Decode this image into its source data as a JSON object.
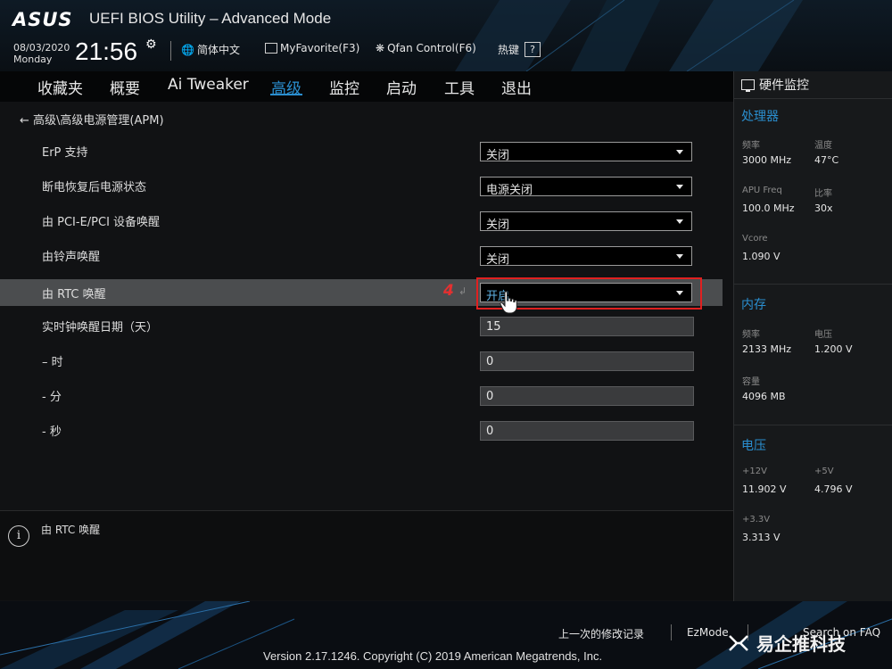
{
  "header": {
    "logo": "ASUS",
    "title": "UEFI BIOS Utility – Advanced Mode",
    "date": "08/03/2020",
    "weekday": "Monday",
    "time": "21:56",
    "tools": {
      "language": "简体中文",
      "myfavorite": "MyFavorite(F3)",
      "qfan": "Qfan Control(F6)",
      "hotkey": "热键",
      "hotkey_key": "?"
    }
  },
  "menu": {
    "items": [
      {
        "label": "收藏夹"
      },
      {
        "label": "概要"
      },
      {
        "label": "Ai Tweaker"
      },
      {
        "label": "高级",
        "active": true
      },
      {
        "label": "监控"
      },
      {
        "label": "启动"
      },
      {
        "label": "工具"
      },
      {
        "label": "退出"
      }
    ]
  },
  "breadcrumb": "高级\\高级电源管理(APM)",
  "settings": [
    {
      "label": "ErP 支持",
      "value": "关闭",
      "kind": "dropdown"
    },
    {
      "label": "断电恢复后电源状态",
      "value": "电源关闭",
      "kind": "dropdown"
    },
    {
      "label": "由 PCI-E/PCI 设备唤醒",
      "value": "关闭",
      "kind": "dropdown"
    },
    {
      "label": "由铃声唤醒",
      "value": "关闭",
      "kind": "dropdown"
    },
    {
      "label": "由 RTC 唤醒",
      "value": "开启",
      "kind": "dropdown",
      "selected": true
    },
    {
      "label": "实时钟唤醒日期（天）",
      "value": "15",
      "kind": "text"
    },
    {
      "label": "– 时",
      "value": "0",
      "kind": "text"
    },
    {
      "label": "- 分",
      "value": "0",
      "kind": "text"
    },
    {
      "label": "- 秒",
      "value": "0",
      "kind": "text"
    }
  ],
  "annotation": {
    "step": "4"
  },
  "info": {
    "text": "由 RTC 唤醒"
  },
  "hw_monitor": {
    "title": "硬件监控",
    "cpu": {
      "title": "处理器",
      "freq_label": "频率",
      "freq": "3000 MHz",
      "temp_label": "温度",
      "temp": "47°C",
      "apu_label": "APU Freq",
      "apu": "100.0 MHz",
      "ratio_label": "比率",
      "ratio": "30x",
      "vcore_label": "Vcore",
      "vcore": "1.090 V"
    },
    "memory": {
      "title": "内存",
      "freq_label": "频率",
      "freq": "2133 MHz",
      "volt_label": "电压",
      "volt": "1.200 V",
      "cap_label": "容量",
      "cap": "4096 MB"
    },
    "voltage": {
      "title": "电压",
      "v12_label": "+12V",
      "v12": "11.902 V",
      "v5_label": "+5V",
      "v5": "4.796 V",
      "v33_label": "+3.3V",
      "v33": "3.313 V"
    }
  },
  "footer": {
    "last_modified": "上一次的修改记录",
    "ezmode": "EzMode",
    "search": "Search on FAQ",
    "version": "Version 2.17.1246. Copyright (C) 2019 American Megatrends, Inc."
  },
  "watermark": "易企推科技",
  "colors": {
    "accent": "#2a8ecf",
    "annotation": "#e02020",
    "highlight_row": "#4b4d4f"
  }
}
